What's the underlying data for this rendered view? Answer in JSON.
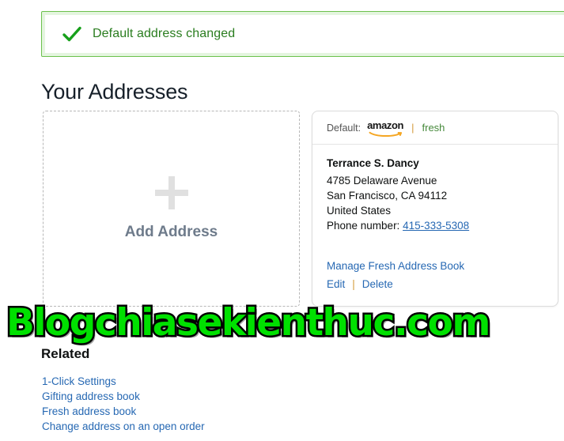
{
  "banner": {
    "icon": "check-icon",
    "message": "Default address changed",
    "border_color": "#6cc14d",
    "text_color": "#2a7d1f"
  },
  "page_title": "Your Addresses",
  "add_tile": {
    "icon": "plus-icon",
    "label": "Add Address"
  },
  "address_card": {
    "header": {
      "default_label": "Default:",
      "brand_primary": "amazon",
      "separator": "|",
      "brand_secondary": "fresh",
      "brand_secondary_color": "#45893a",
      "swoosh_color": "#f5a623"
    },
    "name": "Terrance S. Dancy",
    "street": "4785 Delaware Avenue",
    "city_state_zip": "San Francisco, CA 94112",
    "country": "United States",
    "phone_label": "Phone number:",
    "phone_number": "415-333-5308",
    "manage_link": "Manage Fresh Address Book",
    "edit_link": "Edit",
    "action_separator": "|",
    "delete_link": "Delete",
    "link_color": "#2668b3"
  },
  "related": {
    "heading": "Related",
    "links": [
      "1-Click Settings",
      "Gifting address book",
      "Fresh address book",
      "Change address on an open order"
    ]
  },
  "watermark": {
    "text": "Blogchiasekienthuc.com",
    "fill_color": "#00e000",
    "stroke_color": "#000000"
  }
}
